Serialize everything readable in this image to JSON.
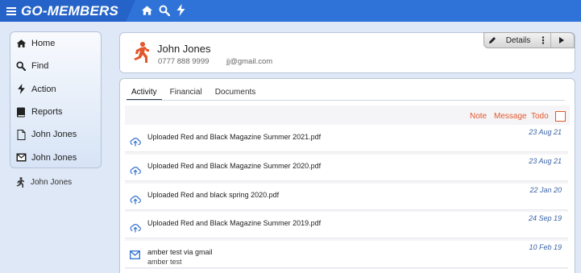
{
  "app": {
    "brand": "GO-MEMBERS",
    "top_icons": [
      "home-icon",
      "search-icon",
      "lightning-icon"
    ]
  },
  "sidebar": {
    "items": [
      {
        "label": "Home",
        "icon": "home-icon"
      },
      {
        "label": "Find",
        "icon": "search-icon"
      },
      {
        "label": "Action",
        "icon": "lightning-icon"
      },
      {
        "label": "Reports",
        "icon": "book-icon"
      },
      {
        "label": "John Jones",
        "icon": "document-icon"
      },
      {
        "label": "John Jones",
        "icon": "envelope-icon"
      }
    ],
    "extra": {
      "label": "John Jones",
      "icon": "runner-icon"
    }
  },
  "contact": {
    "name": "John Jones",
    "phone": "0777 888 9999",
    "email": "jj@gmail.com",
    "details_label": "Details"
  },
  "tabs": [
    {
      "label": "Activity",
      "active": true
    },
    {
      "label": "Financial",
      "active": false
    },
    {
      "label": "Documents",
      "active": false
    }
  ],
  "actions": {
    "note": "Note",
    "message": "Message",
    "todo": "Todo"
  },
  "activity": [
    {
      "icon": "cloud-upload-icon",
      "text": "Uploaded Red and Black Magazine Summer 2021.pdf",
      "sub": "",
      "date": "23 Aug 21"
    },
    {
      "icon": "cloud-upload-icon",
      "text": "Uploaded Red and Black Magazine Summer 2020.pdf",
      "sub": "",
      "date": "23 Aug 21"
    },
    {
      "icon": "cloud-upload-icon",
      "text": "Uploaded Red and black spring 2020.pdf",
      "sub": "",
      "date": "22 Jan 20"
    },
    {
      "icon": "cloud-upload-icon",
      "text": "Uploaded Red and Black Magazine Summer 2019.pdf",
      "sub": "",
      "date": "24 Sep 19"
    },
    {
      "icon": "envelope-icon",
      "text": "amber test via gmail",
      "sub": "amber test",
      "date": "10 Feb 19"
    }
  ],
  "colors": {
    "topbar": "#2f73d8",
    "brand_bg": "#2563c9",
    "accent": "#e2572d",
    "date": "#3a63a8",
    "icon_blue": "#2f6fcf"
  }
}
